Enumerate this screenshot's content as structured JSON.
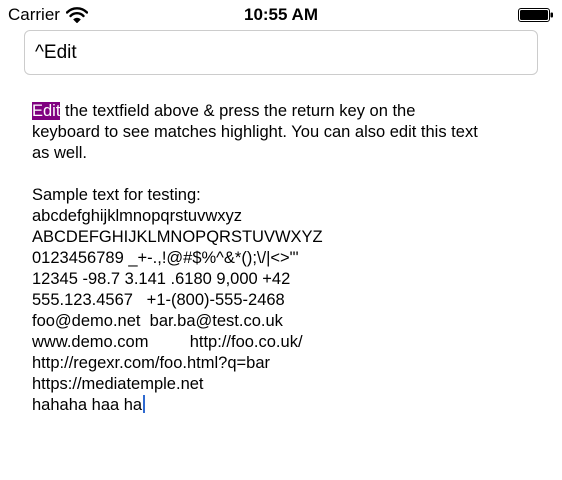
{
  "status_bar": {
    "carrier": "Carrier",
    "time": "10:55 AM"
  },
  "search": {
    "value": "^Edit"
  },
  "body_text": {
    "match": "Edit",
    "paragraph_rest": " the textfield above & press the return key on the\nkeyboard to see matches highlight. You can also edit this text\nas well.\n\nSample text for testing:\nabcdefghijklmnopqrstuvwxyz\nABCDEFGHIJKLMNOPQRSTUVWXYZ\n0123456789 _+-.,!@#$%^&*();\\/|<>\"'\n12345 -98.7 3.141 .6180 9,000 +42\n555.123.4567   +1-(800)-555-2468\nfoo@demo.net  bar.ba@test.co.uk\nwww.demo.com         http://foo.co.uk/\nhttp://regexr.com/foo.html?q=bar\nhttps://mediatemple.net\nhahaha haa ha"
  },
  "colors": {
    "highlight": "#800080",
    "cursor": "#2f6ad0"
  }
}
